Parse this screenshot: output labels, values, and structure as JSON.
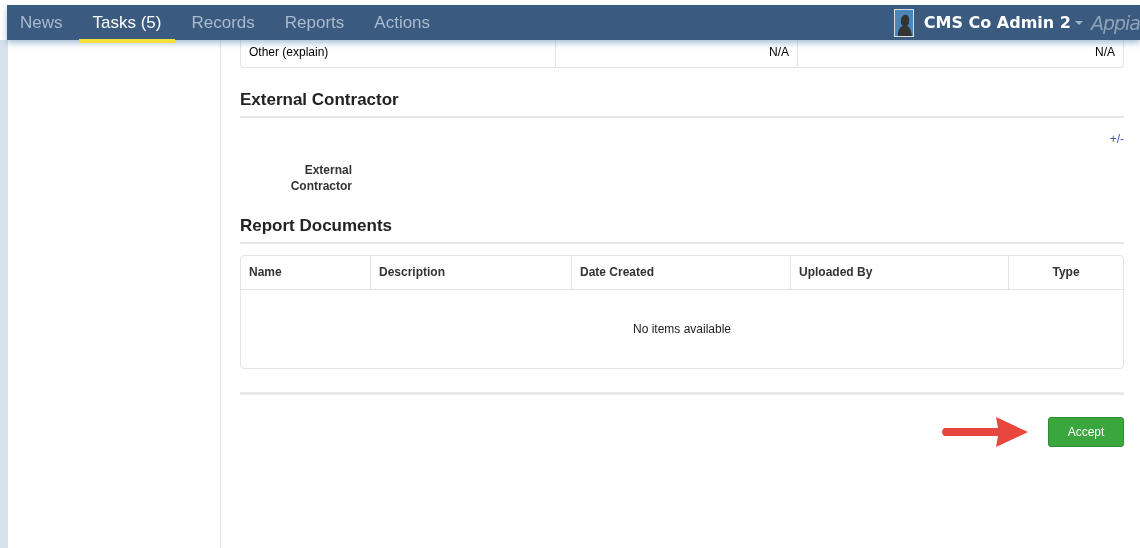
{
  "nav": {
    "tabs": [
      {
        "label": "News",
        "selected": false
      },
      {
        "label": "Tasks (5)",
        "selected": true
      },
      {
        "label": "Records",
        "selected": false
      },
      {
        "label": "Reports",
        "selected": false
      },
      {
        "label": "Actions",
        "selected": false
      }
    ],
    "user": "CMS Co Admin 2",
    "brand": "Appia"
  },
  "other_row": [
    "Other (explain)",
    "N/A",
    "N/A"
  ],
  "external_contractor": {
    "title": "External Contractor",
    "toggle": "+/-",
    "label": "External Contractor"
  },
  "report_documents": {
    "title": "Report Documents",
    "columns": [
      "Name",
      "Description",
      "Date Created",
      "Uploaded By",
      "Type"
    ],
    "empty": "No items available"
  },
  "accept_button": "Accept"
}
